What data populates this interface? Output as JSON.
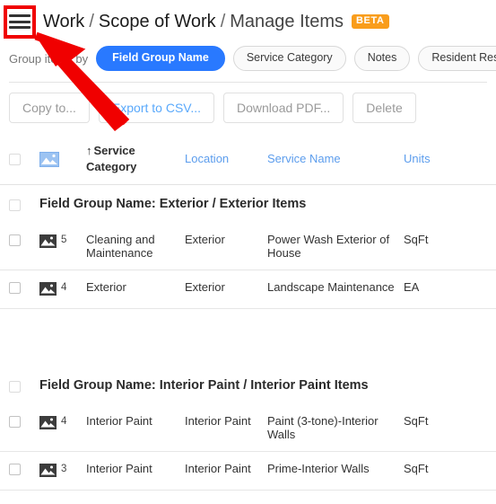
{
  "header": {
    "menu_icon": "hamburger-icon",
    "breadcrumb": [
      "Work",
      "Scope of Work",
      "Manage Items"
    ],
    "separator": "/",
    "badge": "BETA"
  },
  "groupby": {
    "label": "Group items by",
    "options": [
      {
        "label": "Field Group Name",
        "active": true
      },
      {
        "label": "Service Category",
        "active": false
      },
      {
        "label": "Notes",
        "active": false
      },
      {
        "label": "Resident Responsible",
        "active": false
      },
      {
        "label": "",
        "active": false
      }
    ]
  },
  "actions": [
    {
      "label": "Copy to...",
      "enabled": false
    },
    {
      "label": "Export to CSV...",
      "enabled": true
    },
    {
      "label": "Download PDF...",
      "enabled": false
    },
    {
      "label": "Delete",
      "enabled": false
    }
  ],
  "table": {
    "select_all_icon": "checkbox-icon",
    "image_column_icon": "image-icon",
    "columns": [
      {
        "label": "Service Category",
        "sorted": true,
        "sort_dir": "↑"
      },
      {
        "label": "Location",
        "sorted": false
      },
      {
        "label": "Service Name",
        "sorted": false
      },
      {
        "label": "Units",
        "sorted": false
      }
    ],
    "groups": [
      {
        "title": "Field Group Name: Exterior / Exterior Items",
        "rows": [
          {
            "image_count": "5",
            "service_category": "Cleaning and Maintenance",
            "location": "Exterior",
            "service_name": "Power Wash Exterior of House",
            "units": "SqFt"
          },
          {
            "image_count": "4",
            "service_category": "Exterior",
            "location": "Exterior",
            "service_name": "Landscape Maintenance",
            "units": "EA"
          }
        ]
      },
      {
        "title": "Field Group Name: Interior Paint / Interior Paint Items",
        "rows": [
          {
            "image_count": "4",
            "service_category": "Interior Paint",
            "location": "Interior Paint",
            "service_name": "Paint (3-tone)-Interior Walls",
            "units": "SqFt"
          },
          {
            "image_count": "3",
            "service_category": "Interior Paint",
            "location": "Interior Paint",
            "service_name": "Prime-Interior Walls",
            "units": "SqFt"
          }
        ]
      }
    ]
  },
  "annotation": {
    "box_target": "hamburger-icon",
    "color": "#f00000",
    "arrow": "points-to-hamburger-icon"
  },
  "colors": {
    "accent_blue": "#2979ff",
    "link_blue": "#5c9ded",
    "beta_orange": "#f99d1c",
    "annotation_red": "#f00000",
    "header_icon_blue": "#8cb8f0",
    "row_icon_gray": "#3c3c3c"
  }
}
